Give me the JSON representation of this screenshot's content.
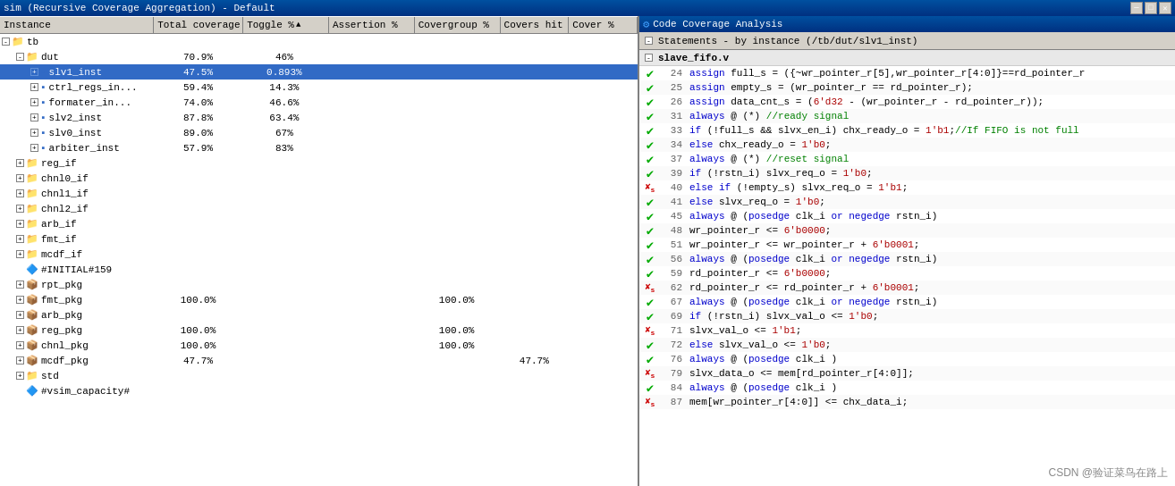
{
  "window": {
    "title": "sim (Recursive Coverage Aggregation) - Default",
    "right_title": "Code Coverage Analysis"
  },
  "left_panel": {
    "columns": [
      {
        "label": "Instance",
        "key": "instance"
      },
      {
        "label": "Total coverage",
        "key": "total"
      },
      {
        "label": "Toggle %",
        "key": "toggle",
        "sort": "▲"
      },
      {
        "label": "Assertion %",
        "key": "assertion"
      },
      {
        "label": "Covergroup %",
        "key": "covergroup"
      },
      {
        "label": "Covers hit",
        "key": "covershit"
      },
      {
        "label": "Cover %",
        "key": "coverp"
      }
    ],
    "tree": [
      {
        "id": "tb",
        "label": "tb",
        "indent": 0,
        "type": "folder",
        "expand": "-",
        "total": "",
        "toggle": "",
        "assertion": "",
        "covergroup": "",
        "covershit": "",
        "coverp": ""
      },
      {
        "id": "dut",
        "label": "dut",
        "indent": 1,
        "type": "folder",
        "expand": "-",
        "total": "70.9%",
        "toggle": "46%",
        "assertion": "",
        "covergroup": "",
        "covershit": "",
        "coverp": ""
      },
      {
        "id": "slv1_inst",
        "label": "slv1_inst",
        "indent": 2,
        "type": "module",
        "expand": "+",
        "total": "47.5%",
        "toggle": "0.893%",
        "assertion": "",
        "covergroup": "",
        "covershit": "",
        "coverp": "",
        "selected": true
      },
      {
        "id": "ctrl_regs_in",
        "label": "ctrl_regs_in...",
        "indent": 2,
        "type": "module",
        "expand": "+",
        "total": "59.4%",
        "toggle": "14.3%",
        "assertion": "",
        "covergroup": "",
        "covershit": "",
        "coverp": ""
      },
      {
        "id": "formater_in",
        "label": "formater_in...",
        "indent": 2,
        "type": "module",
        "expand": "+",
        "total": "74.0%",
        "toggle": "46.6%",
        "assertion": "",
        "covergroup": "",
        "covershit": "",
        "coverp": ""
      },
      {
        "id": "slv2_inst",
        "label": "slv2_inst",
        "indent": 2,
        "type": "module",
        "expand": "+",
        "total": "87.8%",
        "toggle": "63.4%",
        "assertion": "",
        "covergroup": "",
        "covershit": "",
        "coverp": ""
      },
      {
        "id": "slv0_inst",
        "label": "slv0_inst",
        "indent": 2,
        "type": "module",
        "expand": "+",
        "total": "89.0%",
        "toggle": "67%",
        "assertion": "",
        "covergroup": "",
        "covershit": "",
        "coverp": ""
      },
      {
        "id": "arbiter_inst",
        "label": "arbiter_inst",
        "indent": 2,
        "type": "module",
        "expand": "+",
        "total": "57.9%",
        "toggle": "83%",
        "assertion": "",
        "covergroup": "",
        "covershit": "",
        "coverp": ""
      },
      {
        "id": "reg_if",
        "label": "reg_if",
        "indent": 1,
        "type": "folder",
        "expand": "+",
        "total": "",
        "toggle": "",
        "assertion": "",
        "covergroup": "",
        "covershit": "",
        "coverp": ""
      },
      {
        "id": "chnl0_if",
        "label": "chnl0_if",
        "indent": 1,
        "type": "folder",
        "expand": "+",
        "total": "",
        "toggle": "",
        "assertion": "",
        "covergroup": "",
        "covershit": "",
        "coverp": ""
      },
      {
        "id": "chnl1_if",
        "label": "chnl1_if",
        "indent": 1,
        "type": "folder",
        "expand": "+",
        "total": "",
        "toggle": "",
        "assertion": "",
        "covergroup": "",
        "covershit": "",
        "coverp": ""
      },
      {
        "id": "chnl2_if",
        "label": "chnl2_if",
        "indent": 1,
        "type": "folder",
        "expand": "+",
        "total": "",
        "toggle": "",
        "assertion": "",
        "covergroup": "",
        "covershit": "",
        "coverp": ""
      },
      {
        "id": "arb_if",
        "label": "arb_if",
        "indent": 1,
        "type": "folder",
        "expand": "+",
        "total": "",
        "toggle": "",
        "assertion": "",
        "covergroup": "",
        "covershit": "",
        "coverp": ""
      },
      {
        "id": "fmt_if",
        "label": "fmt_if",
        "indent": 1,
        "type": "folder",
        "expand": "+",
        "total": "",
        "toggle": "",
        "assertion": "",
        "covergroup": "",
        "covershit": "",
        "coverp": ""
      },
      {
        "id": "mcdf_if",
        "label": "mcdf_if",
        "indent": 1,
        "type": "folder",
        "expand": "+",
        "total": "",
        "toggle": "",
        "assertion": "",
        "covergroup": "",
        "covershit": "",
        "coverp": ""
      },
      {
        "id": "INITIAL159",
        "label": "#INITIAL#159",
        "indent": 1,
        "type": "initial",
        "expand": null,
        "total": "",
        "toggle": "",
        "assertion": "",
        "covergroup": "",
        "covershit": "",
        "coverp": ""
      },
      {
        "id": "rpt_pkg",
        "label": "rpt_pkg",
        "indent": 1,
        "type": "pkg",
        "expand": "+",
        "total": "",
        "toggle": "",
        "assertion": "",
        "covergroup": "",
        "covershit": "",
        "coverp": ""
      },
      {
        "id": "fmt_pkg",
        "label": "fmt_pkg",
        "indent": 1,
        "type": "pkg",
        "expand": "+",
        "total": "100.0%",
        "toggle": "",
        "assertion": "",
        "covergroup": "100.0%",
        "covershit": "",
        "coverp": ""
      },
      {
        "id": "arb_pkg",
        "label": "arb_pkg",
        "indent": 1,
        "type": "pkg",
        "expand": "+",
        "total": "",
        "toggle": "",
        "assertion": "",
        "covergroup": "",
        "covershit": "",
        "coverp": ""
      },
      {
        "id": "reg_pkg",
        "label": "reg_pkg",
        "indent": 1,
        "type": "pkg",
        "expand": "+",
        "total": "100.0%",
        "toggle": "",
        "assertion": "",
        "covergroup": "100.0%",
        "covershit": "",
        "coverp": ""
      },
      {
        "id": "chnl_pkg",
        "label": "chnl_pkg",
        "indent": 1,
        "type": "pkg",
        "expand": "+",
        "total": "100.0%",
        "toggle": "",
        "assertion": "",
        "covergroup": "100.0%",
        "covershit": "",
        "coverp": ""
      },
      {
        "id": "mcdf_pkg",
        "label": "mcdf_pkg",
        "indent": 1,
        "type": "pkg",
        "expand": "+",
        "total": "47.7%",
        "toggle": "",
        "assertion": "",
        "covergroup": "",
        "covershit": "47.7%",
        "coverp": ""
      },
      {
        "id": "std",
        "label": "std",
        "indent": 1,
        "type": "folder",
        "expand": "+",
        "total": "",
        "toggle": "",
        "assertion": "",
        "covergroup": "",
        "covershit": "",
        "coverp": ""
      },
      {
        "id": "vsim_cap",
        "label": "#vsim_capacity#",
        "indent": 1,
        "type": "initial",
        "expand": null,
        "total": "",
        "toggle": "",
        "assertion": "",
        "covergroup": "",
        "covershit": "",
        "coverp": ""
      }
    ]
  },
  "right_panel": {
    "subtitle": "Statements - by instance (/tb/dut/slv1_inst)",
    "filename": "slave_fifo.v",
    "lines": [
      {
        "num": 24,
        "status": "check",
        "code": "assign full_s = ({~wr_pointer_r[5],wr_pointer_r[4:0]}==rd_pointer_r"
      },
      {
        "num": 25,
        "status": "check",
        "code": "assign empty_s = (wr_pointer_r == rd_pointer_r);"
      },
      {
        "num": 26,
        "status": "check",
        "code": "assign data_cnt_s = (6'd32 - (wr_pointer_r - rd_pointer_r));"
      },
      {
        "num": 31,
        "status": "check",
        "code": "always @ (*) //ready signal"
      },
      {
        "num": 33,
        "status": "check",
        "code": "if (!full_s && slvx_en_i) chx_ready_o = 1'b1;//If FIFO is not full"
      },
      {
        "num": 34,
        "status": "check",
        "code": "else chx_ready_o = 1'b0;"
      },
      {
        "num": 37,
        "status": "check",
        "code": "always @ (*) //reset signal"
      },
      {
        "num": 39,
        "status": "check",
        "code": "if (!rstn_i) slvx_req_o = 1'b0;"
      },
      {
        "num": 40,
        "status": "cross",
        "code": "else if (!empty_s) slvx_req_o = 1'b1;"
      },
      {
        "num": 41,
        "status": "check",
        "code": "else slvx_req_o = 1'b0;"
      },
      {
        "num": 45,
        "status": "check",
        "code": "always @ (posedge clk_i or negedge rstn_i)"
      },
      {
        "num": 48,
        "status": "check",
        "code": "wr_pointer_r <= 6'b0000;"
      },
      {
        "num": 51,
        "status": "check",
        "code": "wr_pointer_r <= wr_pointer_r + 6'b0001;"
      },
      {
        "num": 56,
        "status": "check",
        "code": "always @ (posedge clk_i or negedge rstn_i)"
      },
      {
        "num": 59,
        "status": "check",
        "code": "rd_pointer_r <= 6'b0000;"
      },
      {
        "num": 62,
        "status": "cross",
        "code": "rd_pointer_r <= rd_pointer_r + 6'b0001;"
      },
      {
        "num": 67,
        "status": "check",
        "code": "always @ (posedge clk_i or negedge rstn_i)"
      },
      {
        "num": 69,
        "status": "check",
        "code": "if (!rstn_i) slvx_val_o <= 1'b0;"
      },
      {
        "num": 71,
        "status": "cross",
        "code": "slvx_val_o <= 1'b1;"
      },
      {
        "num": 72,
        "status": "check",
        "code": "else slvx_val_o <= 1'b0;"
      },
      {
        "num": 76,
        "status": "check",
        "code": "always @ (posedge clk_i )"
      },
      {
        "num": 79,
        "status": "cross",
        "code": "slvx_data_o <= mem[rd_pointer_r[4:0]];"
      },
      {
        "num": 84,
        "status": "check",
        "code": "always @ (posedge clk_i )"
      },
      {
        "num": 87,
        "status": "cross",
        "code": "mem[wr_pointer_r[4:0]] <= chx_data_i;"
      }
    ]
  },
  "watermark": "CSDN @验证菜鸟在路上"
}
